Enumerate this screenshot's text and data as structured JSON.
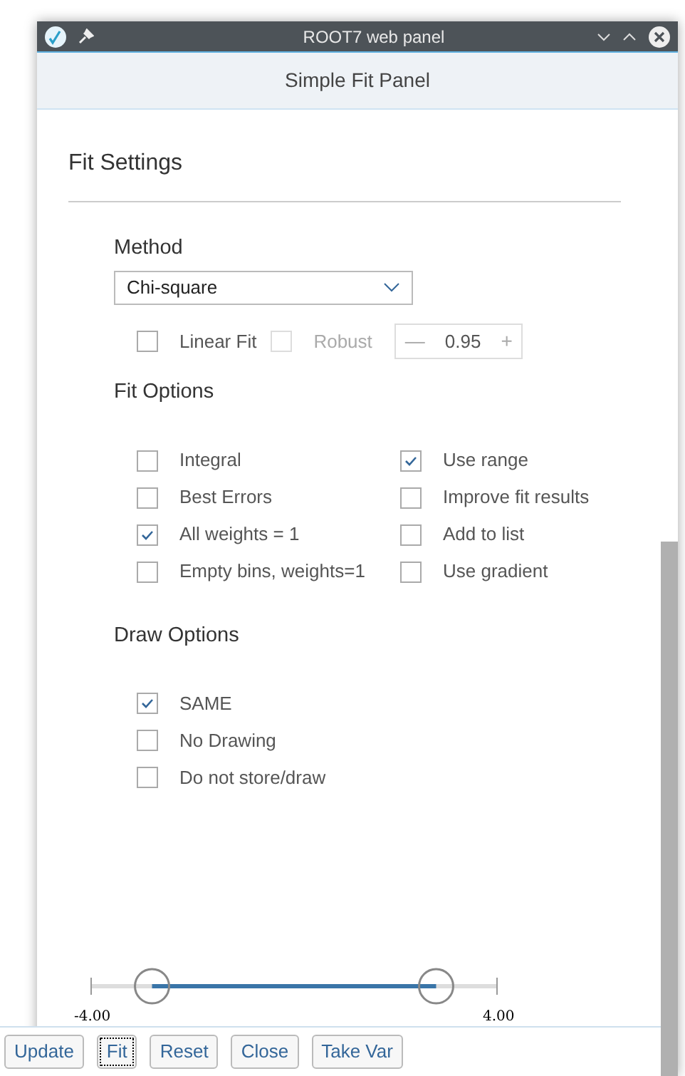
{
  "window": {
    "title": "ROOT7 web panel"
  },
  "header": {
    "title": "Simple Fit Panel"
  },
  "panel": {
    "title": "Fit Settings"
  },
  "method": {
    "label": "Method",
    "value": "Chi-square"
  },
  "linear_options": [
    {
      "label": "Linear Fit",
      "checked": false,
      "disabled": false
    },
    {
      "label": "Robust",
      "checked": false,
      "disabled": true
    }
  ],
  "robust_spin": {
    "minus": "—",
    "value": "0.95",
    "plus": "+",
    "disabled": true
  },
  "fit_options": {
    "title": "Fit Options",
    "items": [
      {
        "label": "Integral",
        "checked": false
      },
      {
        "label": "Use range",
        "checked": true
      },
      {
        "label": "Best Errors",
        "checked": false
      },
      {
        "label": "Improve fit results",
        "checked": false
      },
      {
        "label": "All weights = 1",
        "checked": true
      },
      {
        "label": "Add to list",
        "checked": false
      },
      {
        "label": "Empty bins, weights=1",
        "checked": false
      },
      {
        "label": "Use gradient",
        "checked": false
      }
    ]
  },
  "draw_options": {
    "title": "Draw Options",
    "items": [
      {
        "label": "SAME",
        "checked": true
      },
      {
        "label": "No Drawing",
        "checked": false
      },
      {
        "label": "Do not store/draw",
        "checked": false
      }
    ]
  },
  "range_slider": {
    "min_label": "-4.00",
    "max_label": "4.00",
    "thumbs": [
      {
        "level": 0.15
      },
      {
        "level": 0.85
      }
    ]
  },
  "buttons": [
    {
      "label": "Update",
      "focused": false
    },
    {
      "label": "Fit",
      "focused": true
    },
    {
      "label": "Reset",
      "focused": false
    },
    {
      "label": "Close",
      "focused": false
    },
    {
      "label": "Take Var",
      "focused": false
    }
  ]
}
